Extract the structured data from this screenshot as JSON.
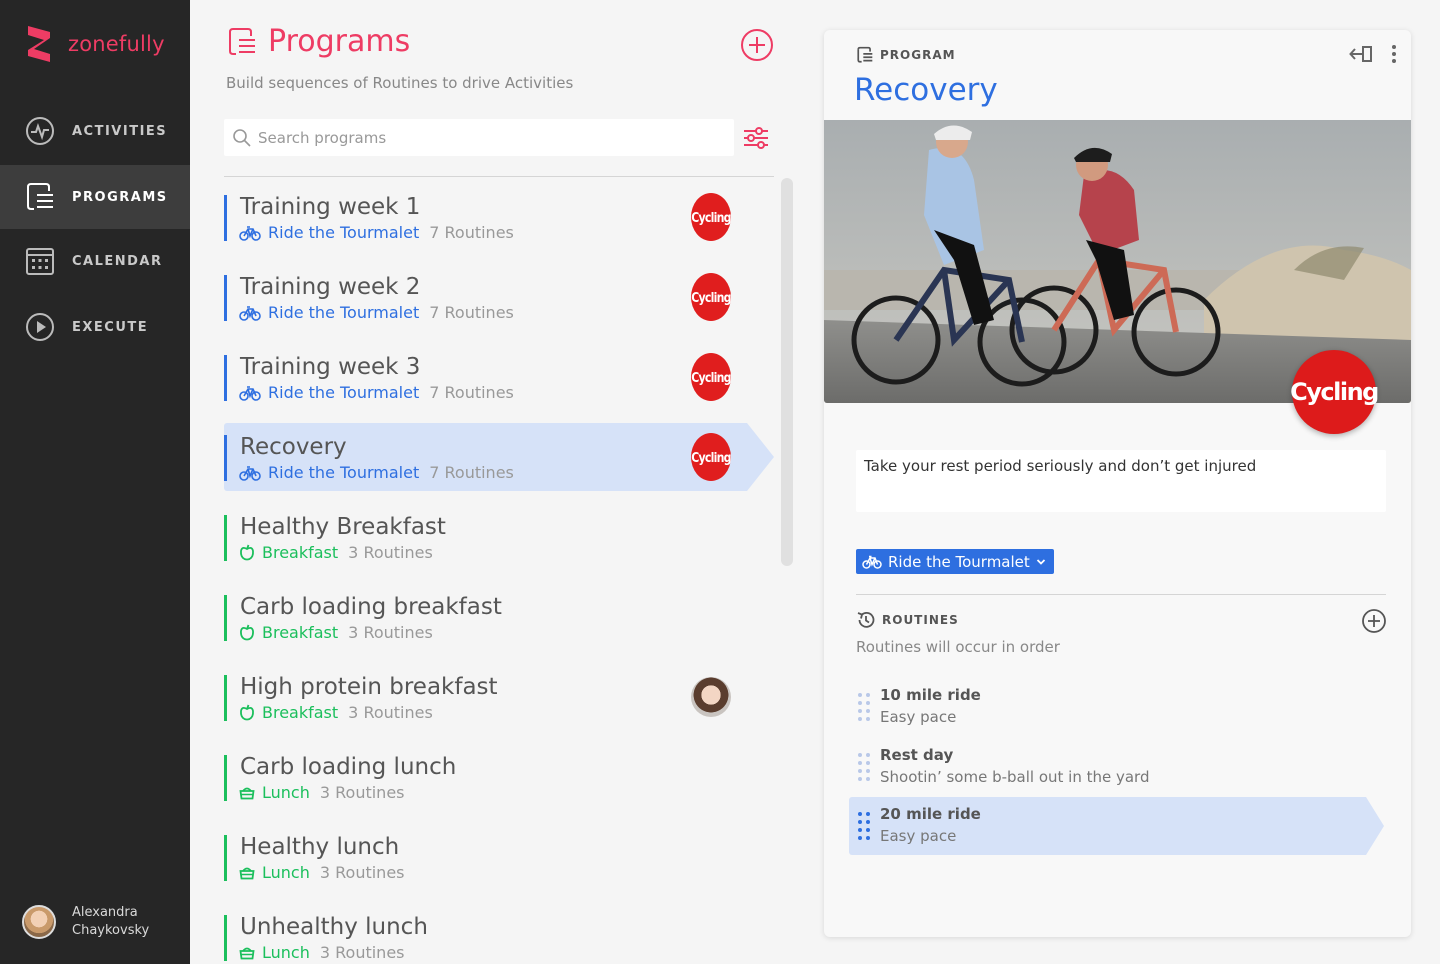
{
  "app": {
    "name": "zonefully"
  },
  "nav": [
    {
      "label": "ACTIVITIES",
      "icon": "activity-icon"
    },
    {
      "label": "PROGRAMS",
      "icon": "programs-icon",
      "active": true
    },
    {
      "label": "CALENDAR",
      "icon": "calendar-icon"
    },
    {
      "label": "EXECUTE",
      "icon": "play-icon"
    }
  ],
  "user": {
    "name_line1": "Alexandra",
    "name_line2": "Chaykovsky"
  },
  "main": {
    "title": "Programs",
    "subtitle": "Build sequences of Routines to drive Activities",
    "search_placeholder": "Search programs"
  },
  "programs": [
    {
      "name": "Training week 1",
      "category": "Ride the Tourmalet",
      "count": "7 Routines",
      "badge": "Cycling"
    },
    {
      "name": "Training week 2",
      "category": "Ride the Tourmalet",
      "count": "7 Routines",
      "badge": "Cycling"
    },
    {
      "name": "Training week 3",
      "category": "Ride the Tourmalet",
      "count": "7 Routines",
      "badge": "Cycling"
    },
    {
      "name": "Recovery",
      "category": "Ride the Tourmalet",
      "count": "7 Routines",
      "badge": "Cycling"
    },
    {
      "name": "Healthy Breakfast",
      "category": "Breakfast",
      "count": "3 Routines"
    },
    {
      "name": "Carb loading breakfast",
      "category": "Breakfast",
      "count": "3 Routines"
    },
    {
      "name": "High protein breakfast",
      "category": "Breakfast",
      "count": "3 Routines"
    },
    {
      "name": "Carb loading lunch",
      "category": "Lunch",
      "count": "3 Routines"
    },
    {
      "name": "Healthy lunch",
      "category": "Lunch",
      "count": "3 Routines"
    },
    {
      "name": "Unhealthy lunch",
      "category": "Lunch",
      "count": "3 Routines"
    }
  ],
  "detail": {
    "label": "PROGRAM",
    "title": "Recovery",
    "hero_badge": "Cycling",
    "description": "Take your rest period seriously and don’t get injured",
    "category": "Ride the Tourmalet",
    "routines_label": "ROUTINES",
    "routines_sub": "Routines will occur in order",
    "routines": [
      {
        "name": "10 mile ride",
        "sub": "Easy pace"
      },
      {
        "name": "Rest day",
        "sub": "Shootin’ some b-ball out in the yard"
      },
      {
        "name": "20 mile ride",
        "sub": "Easy pace"
      }
    ]
  },
  "colors": {
    "brand": "#ee3c64",
    "blue": "#2e6fe0",
    "green": "#1bbf5c",
    "selected": "#d6e2f8",
    "sidebar": "#262626"
  }
}
